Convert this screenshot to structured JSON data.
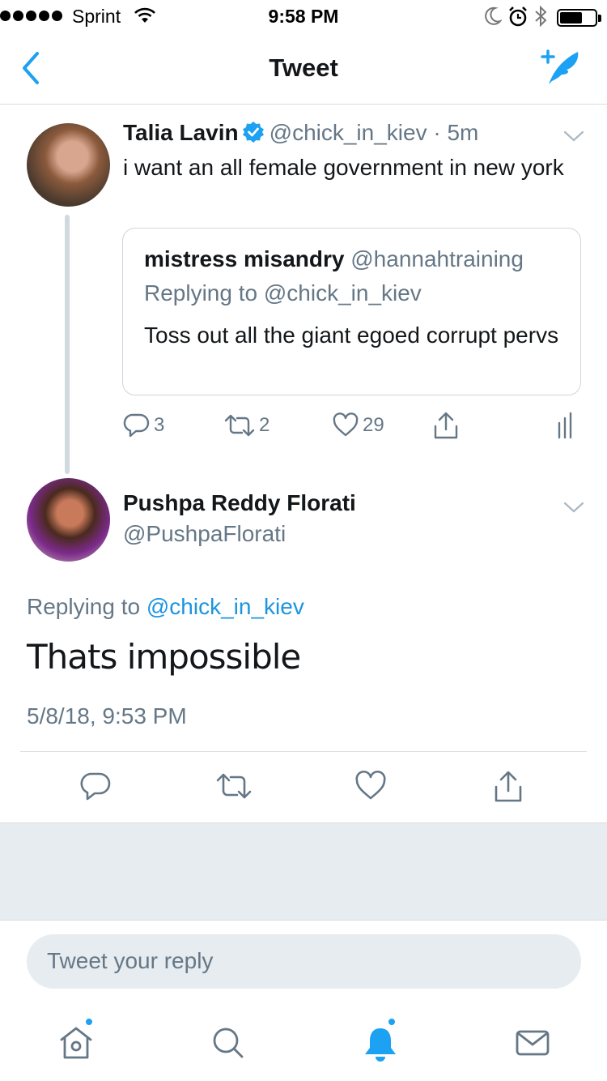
{
  "status_bar": {
    "carrier": "Sprint",
    "time": "9:58 PM"
  },
  "nav": {
    "title": "Tweet"
  },
  "quoted_parent": {
    "name": "Talia Lavin",
    "handle": "@chick_in_kiev",
    "age": "· 5m",
    "text": "i want an all female government in new york",
    "quote": {
      "name": "mistress misandry",
      "handle": "@hannahtraining",
      "replying_to": "Replying to @chick_in_kiev",
      "text": "Toss out all the giant egoed corrupt pervs"
    },
    "counts": {
      "replies": "3",
      "retweets": "2",
      "likes": "29"
    }
  },
  "tweet": {
    "name": "Pushpa Reddy Florati",
    "handle": "@PushpaFlorati",
    "replying_prefix": "Replying to",
    "replying_handle": "@chick_in_kiev",
    "text": "Thats impossible",
    "timestamp": "5/8/18, 9:53 PM"
  },
  "reply_box": {
    "placeholder": "Tweet your reply"
  },
  "colors": {
    "accent": "#1da1f2",
    "secondary_text": "#657786",
    "divider": "#d8dce0",
    "background_grey": "#e6ecf0"
  },
  "icons": [
    "back-chevron-icon",
    "compose-tweet-icon",
    "verified-badge-icon",
    "reply-icon",
    "retweet-icon",
    "like-icon",
    "share-icon",
    "analytics-icon",
    "home-icon",
    "search-icon",
    "notifications-icon",
    "messages-icon"
  ]
}
